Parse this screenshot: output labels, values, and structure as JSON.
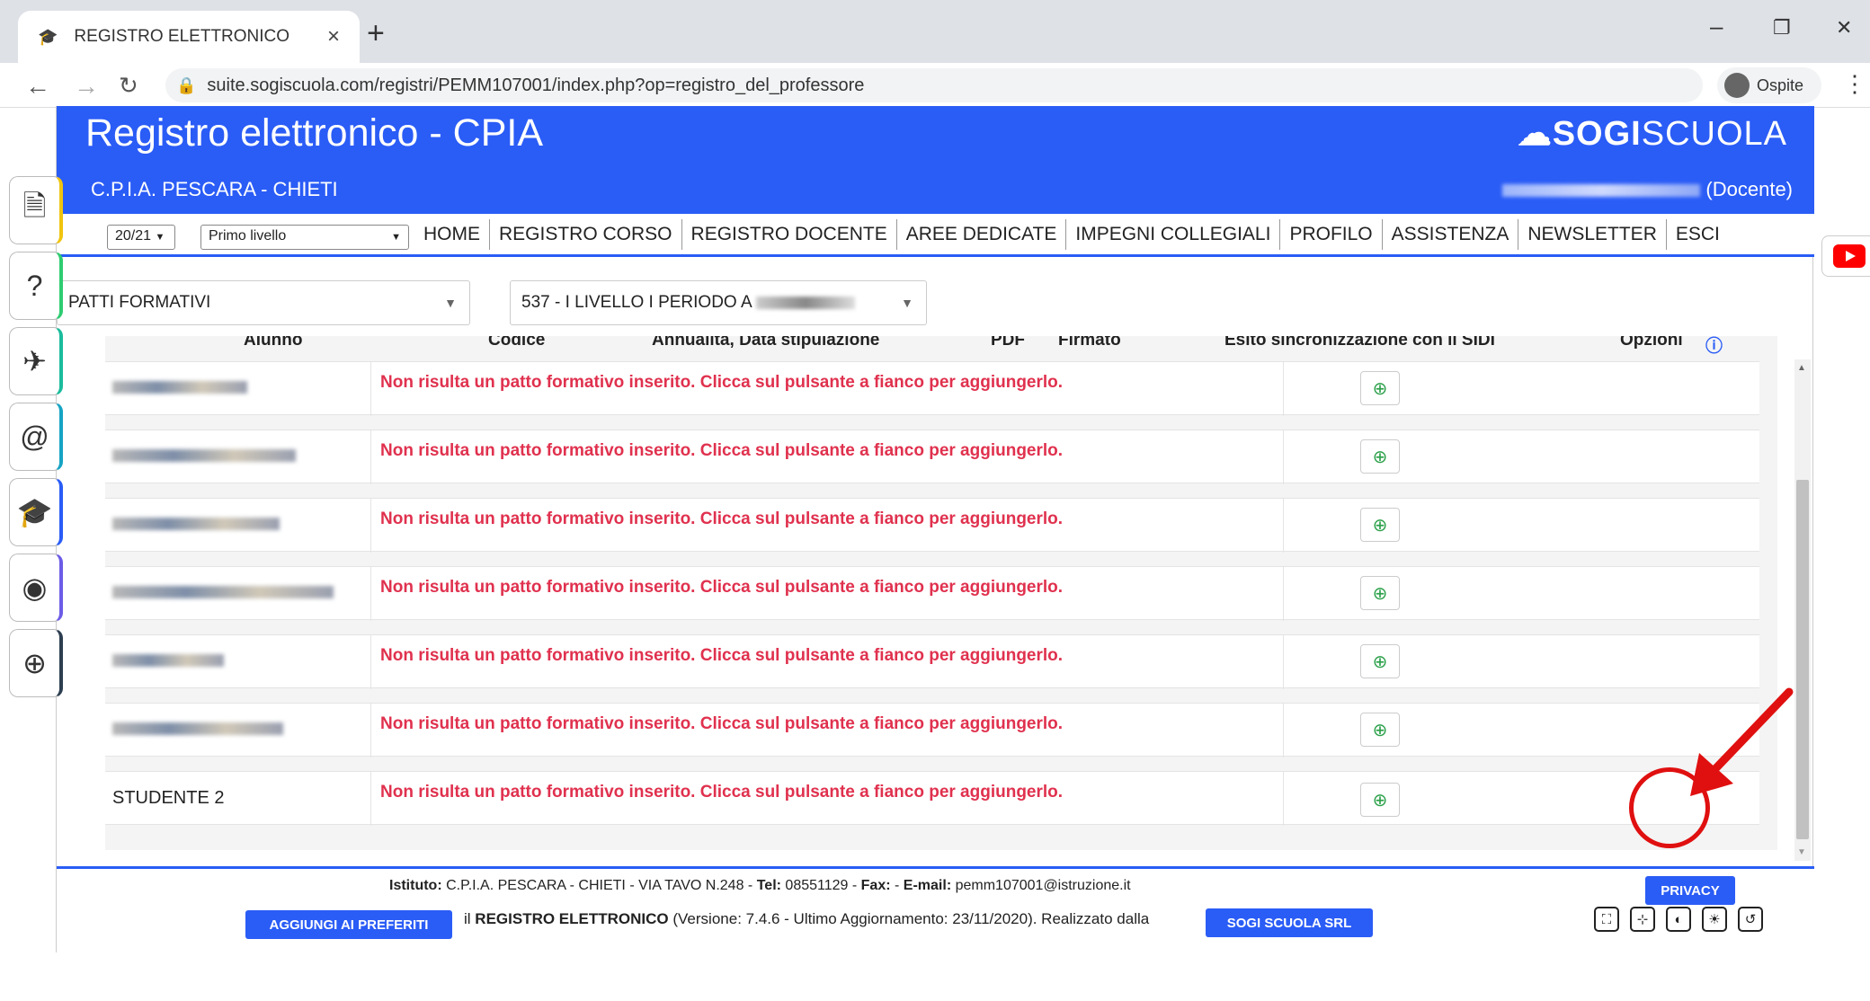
{
  "browser": {
    "tab_title": "REGISTRO ELETTRONICO",
    "tab_close": "×",
    "new_tab": "+",
    "url": "suite.sogiscuola.com/registri/PEMM107001/index.php?op=registro_del_professore",
    "profile_label": "Ospite",
    "controls": {
      "minimize": "–",
      "restore": "❐",
      "close": "✕"
    }
  },
  "header": {
    "title": "Registro elettronico - CPIA",
    "school": "C.P.I.A. PESCARA - CHIETI",
    "logo_bold": "SOGI",
    "logo_light": "SCUOLA",
    "user_role": "(Docente)"
  },
  "toolbar": {
    "year": "20/21",
    "level": "Primo livello",
    "menu": [
      "HOME",
      "REGISTRO CORSO",
      "REGISTRO DOCENTE",
      "AREE DEDICATE",
      "IMPEGNI COLLEGIALI",
      "PROFILO",
      "ASSISTENZA",
      "NEWSLETTER",
      "ESCI"
    ]
  },
  "filters": {
    "section": "PATTI FORMATIVI",
    "course": "537 - I LIVELLO I PERIODO A"
  },
  "table": {
    "columns": [
      "Alunno",
      "Codice",
      "Annualità, Data stipulazione",
      "PDF",
      "Firmato",
      "Esito sincronizzazione con il SIDI",
      "Opzioni"
    ],
    "empty_message": "Non risulta un patto formativo inserito. Clicca sul pulsante a fianco per aggiungerlo.",
    "rows": [
      {
        "student": ""
      },
      {
        "student": ""
      },
      {
        "student": ""
      },
      {
        "student": ""
      },
      {
        "student": ""
      },
      {
        "student": ""
      },
      {
        "student": "STUDENTE 2"
      }
    ],
    "add_icon": "⊕"
  },
  "footer": {
    "istituto_label": "Istituto:",
    "istituto_value": "C.P.I.A. PESCARA - CHIETI - VIA TAVO N.248 -",
    "tel_label": "Tel:",
    "tel_value": "08551129 -",
    "fax_label": "Fax:",
    "fax_value": "- ",
    "email_label": "E-mail:",
    "email_value": "pemm107001@istruzione.it",
    "privacy": "PRIVACY",
    "add_favorites": "AGGIUNGI AI PREFERITI",
    "version_prefix": "il",
    "version_bold": "REGISTRO ELETTRONICO",
    "version_text": "(Versione: 7.4.6 - Ultimo Aggiornamento: 23/11/2020). Realizzato dalla",
    "company": "SOGI SCUOLA SRL"
  },
  "colors": {
    "brand_blue": "#2a5cf6",
    "warning_red": "#e0314e",
    "add_green": "#2da14b",
    "annotation_red": "#e01010"
  }
}
